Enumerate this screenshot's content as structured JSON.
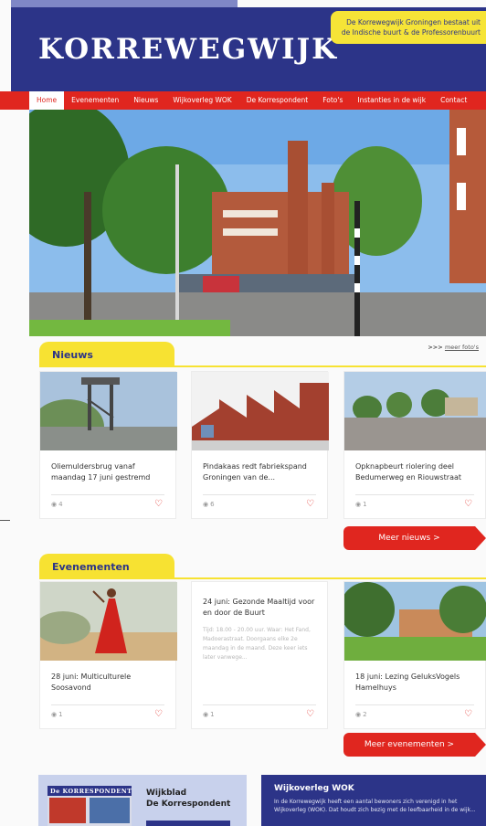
{
  "header": {
    "logo": "KORREWEGWIJK",
    "tagline": "De Korrewegwijk Groningen bestaat uit de Indische buurt & de Professorenbuurt"
  },
  "nav": {
    "items": [
      {
        "label": "Home",
        "active": true
      },
      {
        "label": "Evenementen"
      },
      {
        "label": "Nieuws"
      },
      {
        "label": "Wijkoverleg WOK"
      },
      {
        "label": "De Korrespondent"
      },
      {
        "label": "Foto's"
      },
      {
        "label": "Instanties in de wijk"
      },
      {
        "label": "Contact"
      }
    ]
  },
  "news": {
    "heading": "Nieuws",
    "more_photos_prefix": ">>> ",
    "more_photos_link": "meer foto's",
    "cards": [
      {
        "title": "Oliemuldersbrug vanaf maandag 17 juni gestremd",
        "views": "4"
      },
      {
        "title": "Pindakaas redt fabriekspand Groningen van de...",
        "views": "6"
      },
      {
        "title": "Opknapbeurt riolering deel Bedumerweg en Riouwstraat",
        "views": "1"
      }
    ],
    "more_button": "Meer nieuws >"
  },
  "events": {
    "heading": "Evenementen",
    "cards": [
      {
        "title": "28 juni: Multiculturele Soosavond",
        "views": "1"
      },
      {
        "title": "24 juni: Gezonde Maaltijd voor en door de Buurt",
        "body": "Tijd: 18.00 - 20.00 uur. Waar: Het Fand, Madoerastraat. Doorgaans elke 2e maandag in de maand. Deze keer iets later vanwege...",
        "views": "1"
      },
      {
        "title": "18 juni: Lezing GeluksVogels Hamelhuys",
        "views": "2"
      }
    ],
    "more_button": "Meer evenementen >"
  },
  "magazine": {
    "cover_title": "De KORRESPONDENT",
    "title_line1": "Wijkblad",
    "title_line2": "De Korrespondent"
  },
  "wok": {
    "title": "Wijkoverleg WOK",
    "desc": "In de Korrewegwijk heeft een aantal bewoners zich verenigd in het Wijkoverleg (WOK). Dat houdt zich bezig met de leefbaarheid in de wijk..."
  },
  "colors": {
    "brand_blue": "#2c3488",
    "accent_red": "#e0261f",
    "accent_yellow": "#f7e232"
  }
}
